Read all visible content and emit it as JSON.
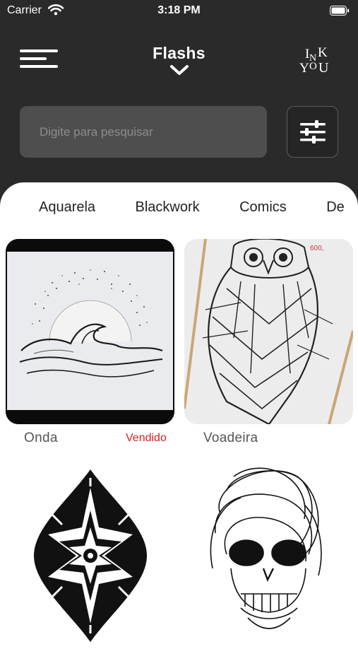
{
  "status_bar": {
    "carrier": "Carrier",
    "time": "3:18 PM"
  },
  "header": {
    "title": "Flashs",
    "logo_text": "INK YOU"
  },
  "search": {
    "placeholder": "Digite para pesquisar",
    "value": ""
  },
  "categories": [
    "Aquarela",
    "Blackwork",
    "Comics",
    "De"
  ],
  "flashes": [
    {
      "name": "Onda",
      "badge": "Vendido"
    },
    {
      "name": "Voadeira",
      "badge": ""
    },
    {
      "name": "",
      "badge": ""
    },
    {
      "name": "",
      "badge": ""
    }
  ],
  "colors": {
    "background": "#2a2a2a",
    "search_bg": "#4e4e4e",
    "sheet": "#ffffff",
    "sold": "#d2232a"
  },
  "icons": [
    "wifi-icon",
    "battery-icon",
    "menu-icon",
    "chevron-down-icon",
    "filter-sliders-icon"
  ]
}
